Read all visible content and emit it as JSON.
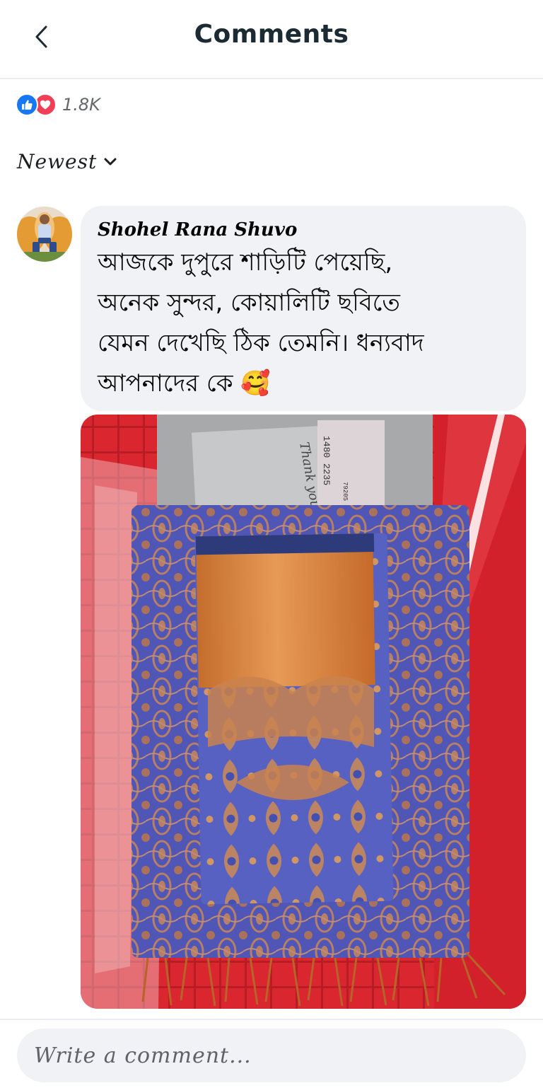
{
  "header": {
    "title": "Comments",
    "back_icon": "chevron-left-icon"
  },
  "reactions": {
    "icons": [
      "like-icon",
      "love-icon"
    ],
    "count": "1.8K",
    "like_color": "#1877f2",
    "love_color": "#f33e58"
  },
  "sort": {
    "label": "Newest",
    "icon": "chevron-down-icon"
  },
  "comment": {
    "author": "Shohel Rana Shuvo",
    "lines": [
      "আজকে দুপুরে শাড়িটি পেয়েছি,",
      "অনেক সুন্দর,  কোয়ালিটি ছবিতে",
      "যেমন দেখেছি ঠিক তেমনি।  ধন্যবাদ",
      "আপনাদের কে 🥰"
    ],
    "photo_caption": "Thank you",
    "photo_slip_number": "1480 2235",
    "photo_slip_code": "79205"
  },
  "composer": {
    "placeholder": "Write a comment..."
  },
  "colors": {
    "bubble_bg": "#f0f2f5",
    "text": "#050505",
    "secondary": "#65676b"
  }
}
